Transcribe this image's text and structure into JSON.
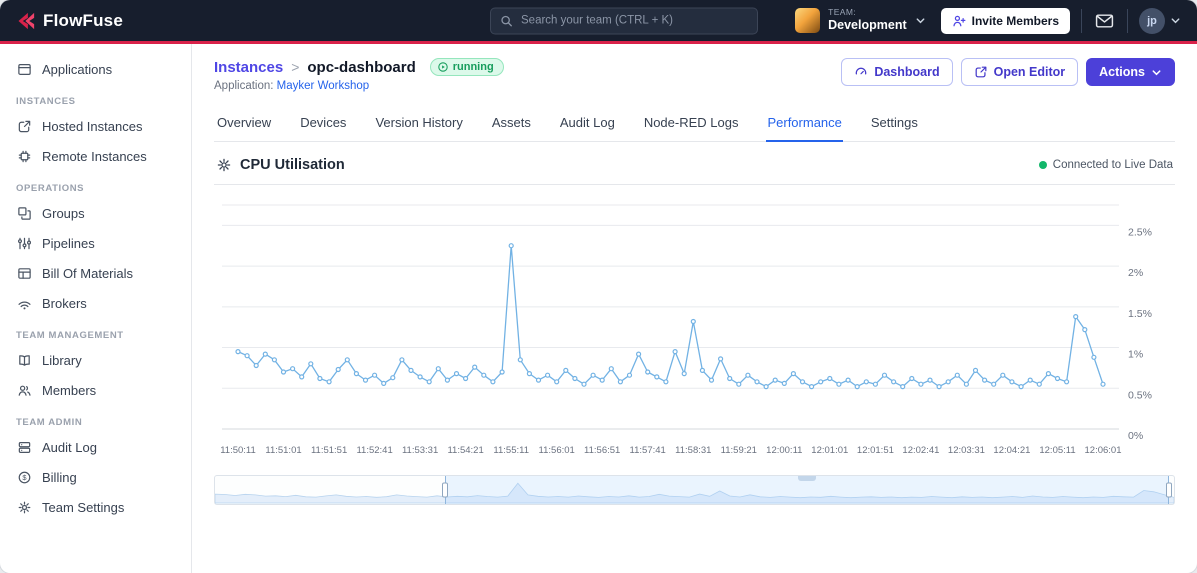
{
  "topbar": {
    "brand": "FlowFuse",
    "search_placeholder": "Search your team (CTRL + K)",
    "team_label": "TEAM:",
    "team_name": "Development",
    "invite_button": "Invite Members",
    "user_initials": "jp"
  },
  "sidebar": {
    "items_main": [
      {
        "label": "Applications"
      }
    ],
    "sections": [
      {
        "title": "INSTANCES",
        "items": [
          {
            "label": "Hosted Instances"
          },
          {
            "label": "Remote Instances"
          }
        ]
      },
      {
        "title": "OPERATIONS",
        "items": [
          {
            "label": "Groups"
          },
          {
            "label": "Pipelines"
          },
          {
            "label": "Bill Of Materials"
          },
          {
            "label": "Brokers"
          }
        ]
      },
      {
        "title": "TEAM MANAGEMENT",
        "items": [
          {
            "label": "Library"
          },
          {
            "label": "Members"
          }
        ]
      },
      {
        "title": "TEAM ADMIN",
        "items": [
          {
            "label": "Audit Log"
          },
          {
            "label": "Billing"
          },
          {
            "label": "Team Settings"
          }
        ]
      }
    ]
  },
  "page": {
    "breadcrumb": {
      "root": "Instances",
      "separator": ">",
      "current": "opc-dashboard"
    },
    "status_badge": "running",
    "application_label": "Application:",
    "application_name": "Mayker Workshop",
    "actions": {
      "dashboard": "Dashboard",
      "open_editor": "Open Editor",
      "actions": "Actions"
    },
    "tabs": [
      {
        "label": "Overview"
      },
      {
        "label": "Devices"
      },
      {
        "label": "Version History"
      },
      {
        "label": "Assets"
      },
      {
        "label": "Audit Log"
      },
      {
        "label": "Node-RED Logs"
      },
      {
        "label": "Performance"
      },
      {
        "label": "Settings"
      }
    ],
    "active_tab": "Performance"
  },
  "panel": {
    "title": "CPU Utilisation",
    "live_status": "Connected to Live Data"
  },
  "chart_data": {
    "type": "line",
    "title": "CPU Utilisation",
    "unit": "%",
    "grid": "horizontal",
    "legend": "none",
    "y_axis_max": 2.75,
    "y_ticks": [
      {
        "value": 0,
        "label": "0%"
      },
      {
        "value": 0.5,
        "label": "0.5%"
      },
      {
        "value": 1,
        "label": "1%"
      },
      {
        "value": 1.5,
        "label": "1.5%"
      },
      {
        "value": 2,
        "label": "2%"
      },
      {
        "value": 2.5,
        "label": "2.5%"
      }
    ],
    "x_tick_labels": [
      "11:50:11",
      "11:51:01",
      "11:51:51",
      "11:52:41",
      "11:53:31",
      "11:54:21",
      "11:55:11",
      "11:56:01",
      "11:56:51",
      "11:57:41",
      "11:58:31",
      "11:59:21",
      "12:00:11",
      "12:01:01",
      "12:01:51",
      "12:02:41",
      "12:03:31",
      "12:04:21",
      "12:05:11",
      "12:06:01"
    ],
    "points_per_tick": 5,
    "values": [
      0.95,
      0.9,
      0.78,
      0.92,
      0.85,
      0.7,
      0.74,
      0.64,
      0.8,
      0.62,
      0.58,
      0.73,
      0.85,
      0.68,
      0.6,
      0.66,
      0.56,
      0.63,
      0.85,
      0.72,
      0.64,
      0.58,
      0.74,
      0.6,
      0.68,
      0.62,
      0.76,
      0.66,
      0.58,
      0.7,
      2.25,
      0.85,
      0.68,
      0.6,
      0.66,
      0.58,
      0.72,
      0.62,
      0.55,
      0.66,
      0.6,
      0.74,
      0.58,
      0.66,
      0.92,
      0.7,
      0.64,
      0.58,
      0.95,
      0.68,
      1.32,
      0.72,
      0.6,
      0.86,
      0.62,
      0.55,
      0.66,
      0.58,
      0.52,
      0.6,
      0.56,
      0.68,
      0.58,
      0.52,
      0.58,
      0.62,
      0.55,
      0.6,
      0.52,
      0.58,
      0.55,
      0.66,
      0.58,
      0.52,
      0.62,
      0.55,
      0.6,
      0.52,
      0.58,
      0.66,
      0.55,
      0.72,
      0.6,
      0.55,
      0.66,
      0.58,
      0.52,
      0.6,
      0.55,
      0.68,
      0.62,
      0.58,
      1.38,
      1.22,
      0.88,
      0.55
    ],
    "line_color": "#72b2e4",
    "zoom_window": {
      "start_pct": 24,
      "end_pct": 99.5
    }
  }
}
